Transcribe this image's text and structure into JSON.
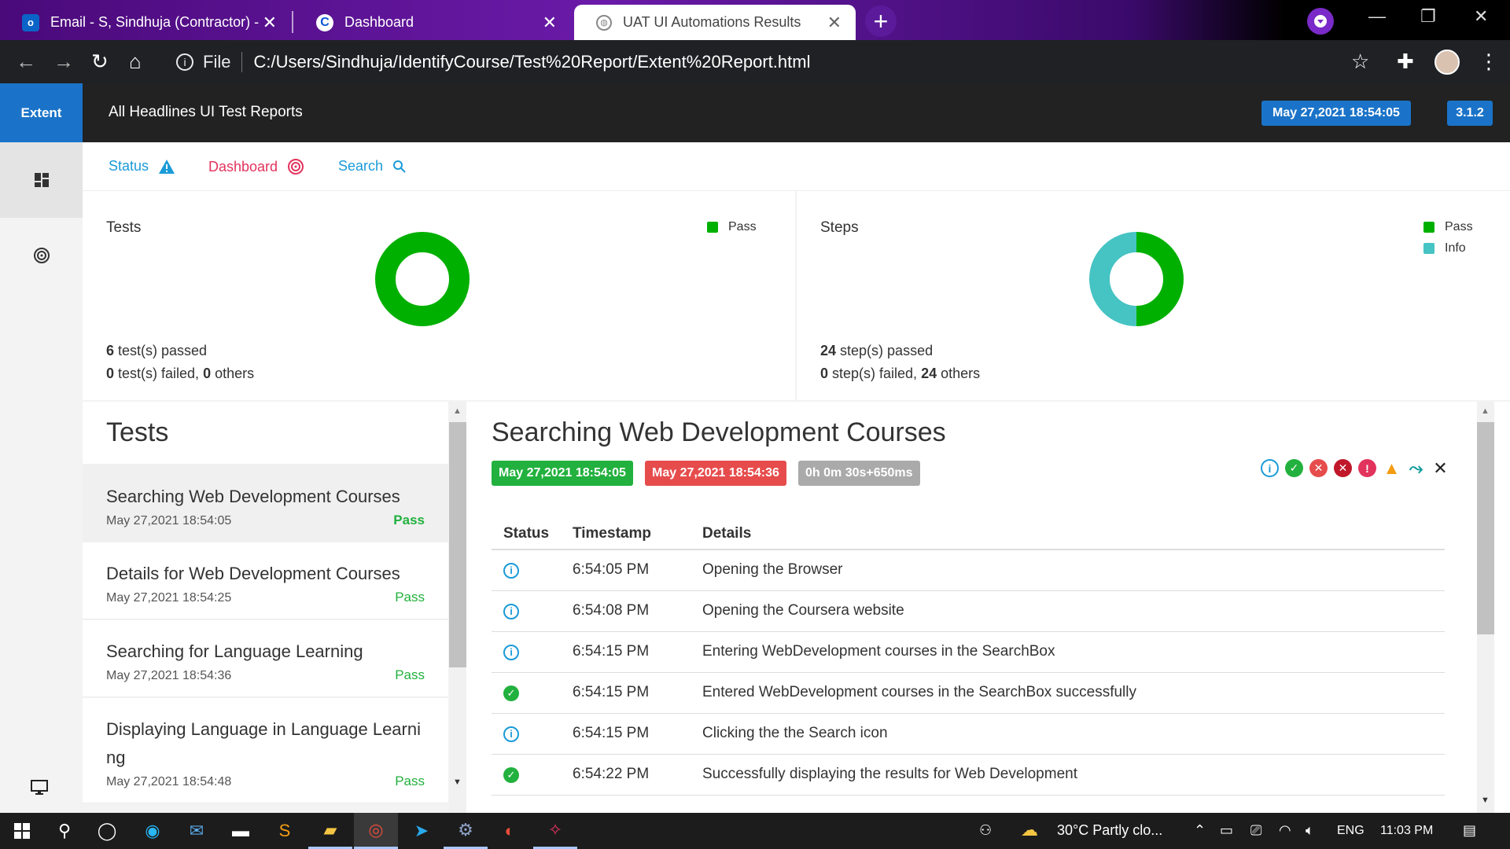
{
  "browser": {
    "tabs": [
      {
        "title": "Email - S, Sindhuja (Contractor) -",
        "icon": "outlook-icon"
      },
      {
        "title": "Dashboard",
        "icon": "coursera-icon"
      },
      {
        "title": "UAT UI Automations Results",
        "icon": "globe-icon",
        "active": true
      }
    ],
    "address": {
      "scheme_label": "File",
      "url": "C:/Users/Sindhuja/IdentifyCourse/Test%20Report/Extent%20Report.html"
    }
  },
  "app": {
    "brand": "Extent",
    "report_title": "All Headlines UI Test Reports",
    "timestamp": "May 27,2021 18:54:05",
    "version": "3.1.2",
    "accent": "#1a73c8"
  },
  "nav": {
    "status": "Status",
    "dashboard": "Dashboard",
    "search": "Search"
  },
  "dashboard": {
    "tests": {
      "title": "Tests",
      "legend": [
        "Pass"
      ],
      "passed_count": "6",
      "passed_text": " test(s) passed",
      "failed_count": "0",
      "failed_text": " test(s) failed, ",
      "others_count": "0",
      "others_text": " others",
      "donut": {
        "pass": 6,
        "info": 0
      }
    },
    "steps": {
      "title": "Steps",
      "legend": [
        "Pass",
        "Info"
      ],
      "passed_count": "24",
      "passed_text": " step(s) passed",
      "failed_count": "0",
      "failed_text": " step(s) failed, ",
      "others_count": "24",
      "others_text": " others",
      "donut": {
        "pass": 0.5,
        "info": 0.5
      }
    },
    "colors": {
      "pass": "#00b000",
      "info": "#46c3c3"
    }
  },
  "tests_panel": {
    "title": "Tests",
    "items": [
      {
        "name": "Searching Web Development Courses",
        "date": "May 27,2021 18:54:05",
        "status": "Pass"
      },
      {
        "name": "Details for Web Development Courses",
        "date": "May 27,2021 18:54:25",
        "status": "Pass"
      },
      {
        "name": "Searching for Language Learning",
        "date": "May 27,2021 18:54:36",
        "status": "Pass"
      },
      {
        "name": "Displaying Language in Language Learni ng",
        "date": "May 27,2021 18:54:48",
        "status": "Pass"
      }
    ]
  },
  "detail": {
    "title": "Searching Web Development Courses",
    "start": "May 27,2021 18:54:05",
    "end": "May 27,2021 18:54:36",
    "duration": "0h 0m 30s+650ms",
    "columns": [
      "Status",
      "Timestamp",
      "Details"
    ],
    "logs": [
      {
        "status": "info",
        "time": "6:54:05 PM",
        "details": "Opening the Browser"
      },
      {
        "status": "info",
        "time": "6:54:08 PM",
        "details": "Opening the Coursera website"
      },
      {
        "status": "info",
        "time": "6:54:15 PM",
        "details": "Entering WebDevelopment courses in the SearchBox"
      },
      {
        "status": "pass",
        "time": "6:54:15 PM",
        "details": "Entered WebDevelopment courses in the SearchBox successfully"
      },
      {
        "status": "info",
        "time": "6:54:15 PM",
        "details": "Clicking the the Search icon"
      },
      {
        "status": "pass",
        "time": "6:54:22 PM",
        "details": "Successfully displaying the results for Web Development"
      }
    ]
  },
  "taskbar": {
    "weather": "30°C  Partly clo...",
    "language": "ENG",
    "clock": "11:03 PM"
  }
}
